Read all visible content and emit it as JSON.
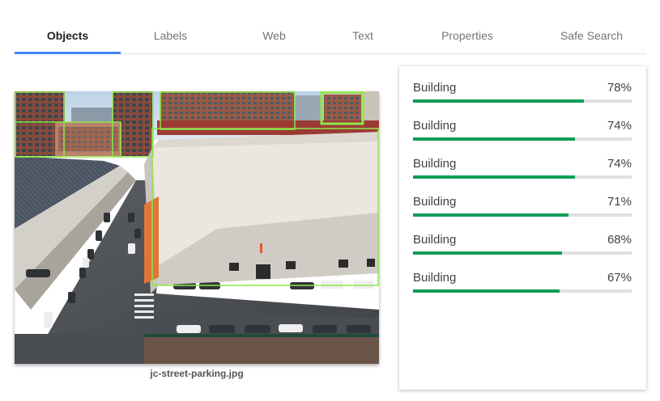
{
  "tabs": [
    {
      "label": "Objects",
      "active": true
    },
    {
      "label": "Labels",
      "active": false
    },
    {
      "label": "Web",
      "active": false
    },
    {
      "label": "Text",
      "active": false
    },
    {
      "label": "Properties",
      "active": false
    },
    {
      "label": "Safe Search",
      "active": false
    }
  ],
  "image": {
    "filename": "jc-street-parking.jpg"
  },
  "results": [
    {
      "name": "Building",
      "score": "78%",
      "fraction": 0.78
    },
    {
      "name": "Building",
      "score": "74%",
      "fraction": 0.74
    },
    {
      "name": "Building",
      "score": "74%",
      "fraction": 0.74
    },
    {
      "name": "Building",
      "score": "71%",
      "fraction": 0.71
    },
    {
      "name": "Building",
      "score": "68%",
      "fraction": 0.68
    },
    {
      "name": "Building",
      "score": "67%",
      "fraction": 0.67
    }
  ],
  "colors": {
    "tab_indicator": "#4285f4",
    "score_bar": "#0f9d58",
    "bounding_box": "#8ee84b"
  }
}
